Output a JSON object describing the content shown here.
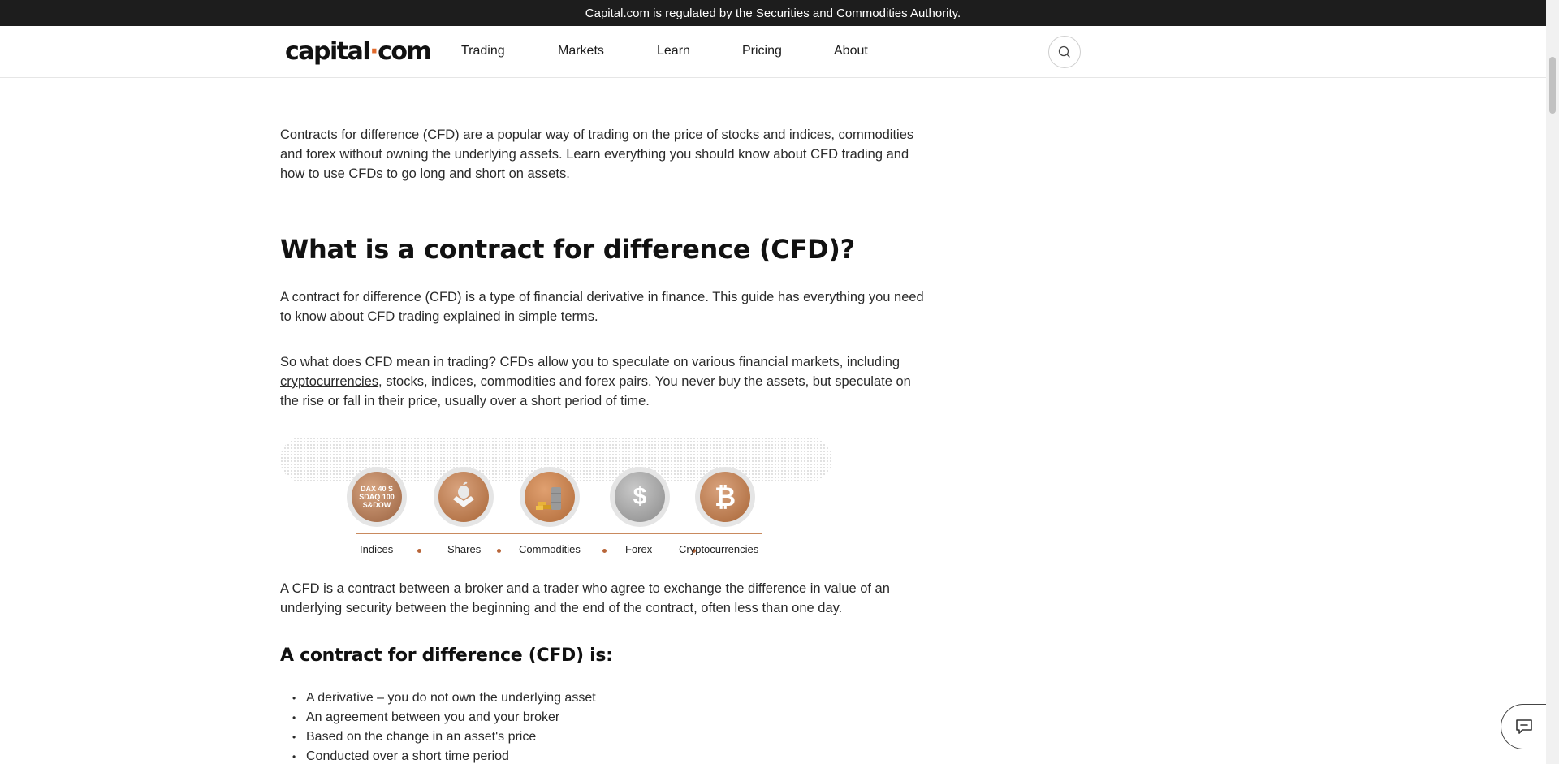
{
  "topbar": {
    "text": "Capital.com is regulated by the Securities and Commodities Authority."
  },
  "nav": {
    "logo": {
      "left": "capital",
      "dot": "·",
      "right": "com"
    },
    "items": [
      {
        "label": "Trading"
      },
      {
        "label": "Markets"
      },
      {
        "label": "Learn"
      },
      {
        "label": "Pricing"
      },
      {
        "label": "About"
      }
    ]
  },
  "article": {
    "intro": "Contracts for difference (CFD) are a popular way of trading on the price of stocks and indices, commodities and forex without owning the underlying assets. Learn everything you should know about CFD trading and how to use CFDs to go long and short on assets.",
    "heading": "What is a contract for difference (CFD)?",
    "para1": "A contract for difference (CFD) is a type of financial derivative in finance. This guide has everything you need to know about CFD trading explained in simple terms.",
    "para2_before": "So what does CFD mean in trading? CFDs allow you to speculate on various financial markets, including ",
    "para2_link": "cryptocurrencies",
    "para2_after": ", stocks, indices, commodities and forex pairs. You never buy the assets, but speculate on the rise or fall in their price, usually over a short period of time.",
    "banner": {
      "assets": [
        {
          "label": "Indices",
          "icon": "indices-icon",
          "glyph": "DAX 40 S&P NASDAQ DOW"
        },
        {
          "label": "Shares",
          "icon": "apple-icon",
          "glyph": ""
        },
        {
          "label": "Commodities",
          "icon": "gold-oil-icon",
          "glyph": ""
        },
        {
          "label": "Forex",
          "icon": "dollar-globe-icon",
          "glyph": "$"
        },
        {
          "label": "Cryptocurrencies",
          "icon": "bitcoin-icon",
          "glyph": "₿"
        }
      ]
    },
    "para3": "A CFD is a contract between a broker and a trader who agree to exchange the difference in value of an underlying security between the beginning and the end of the contract, often less than one day.",
    "subheading": "A contract for difference (CFD) is:",
    "bullets": [
      "A derivative – you do not own the underlying asset",
      "An agreement between you and your broker",
      "Based on the change in an asset's price",
      "Conducted over a short time period"
    ]
  },
  "colors": {
    "accent": "#e06a2c",
    "topbar": "#1d1d1d",
    "banner_line": "#c98a5e"
  }
}
